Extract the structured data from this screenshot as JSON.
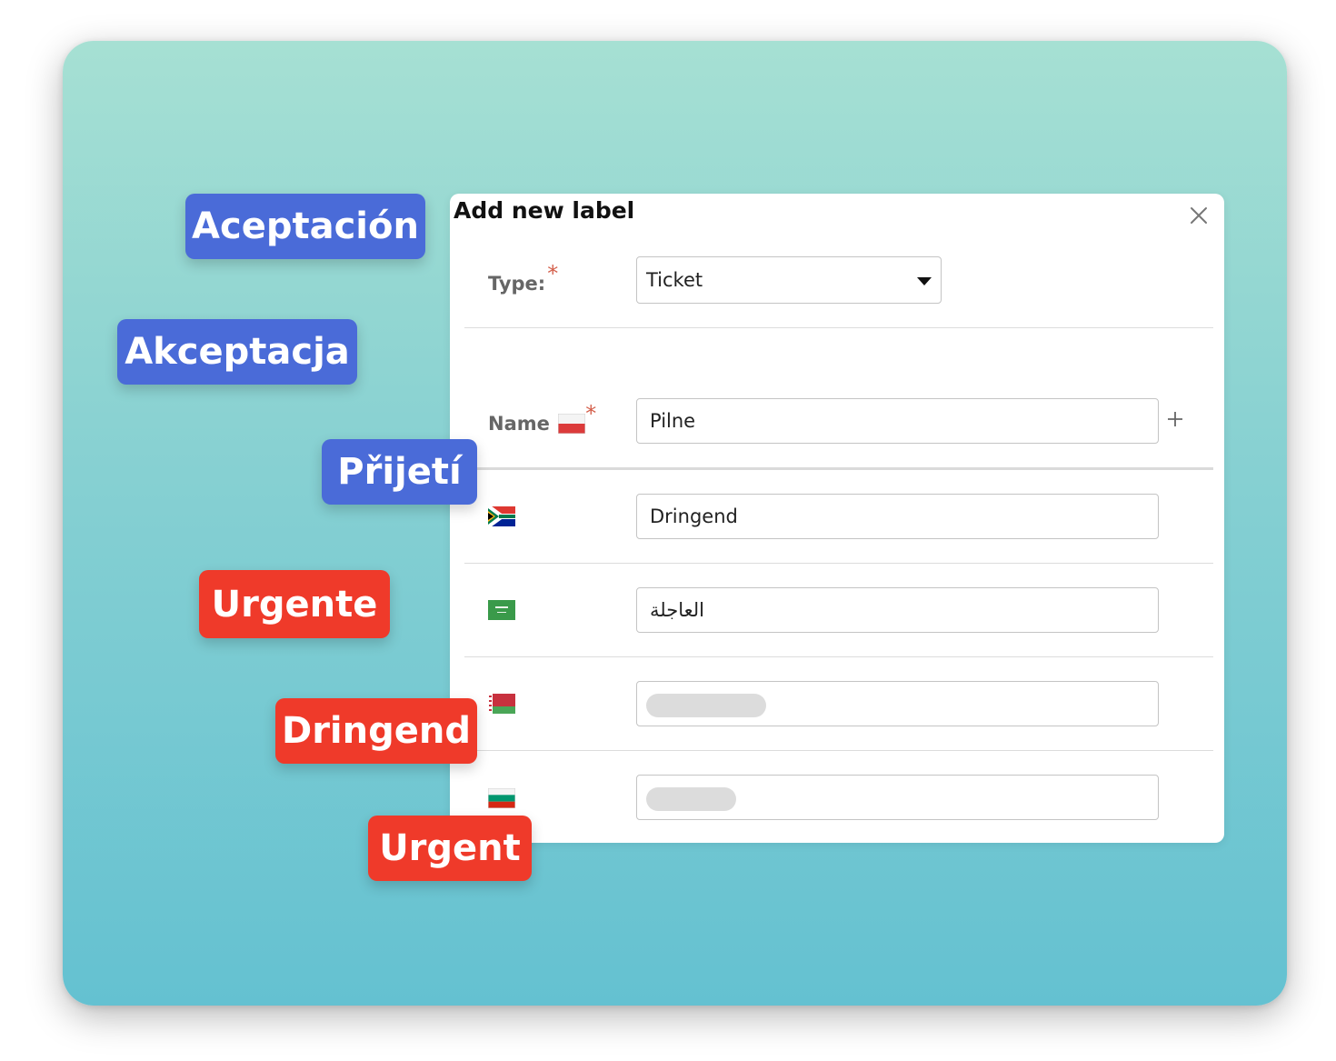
{
  "modal": {
    "title": "Add new label",
    "type_label": "Type:",
    "required_mark": "*",
    "type_value": "Ticket",
    "name_label": "Name",
    "name_value": "Pilne",
    "translations": [
      {
        "flag": "south-africa-flag",
        "value": "Dringend"
      },
      {
        "flag": "saudi-arabia-flag",
        "value": "العاجلة"
      },
      {
        "flag": "belarus-flag",
        "value": ""
      },
      {
        "flag": "bulgaria-flag",
        "value": ""
      }
    ]
  },
  "tags": {
    "blue": [
      "Aceptación",
      "Akceptacja",
      "Přijetí"
    ],
    "red": [
      "Urgente",
      "Dringend",
      "Urgent"
    ]
  },
  "colors": {
    "tag_blue": "#4a6bd8",
    "tag_red": "#ef3a2a",
    "required": "#d4604c"
  },
  "icons": {
    "close": "close-icon",
    "dropdown": "caret-down-icon",
    "add": "plus-icon"
  }
}
